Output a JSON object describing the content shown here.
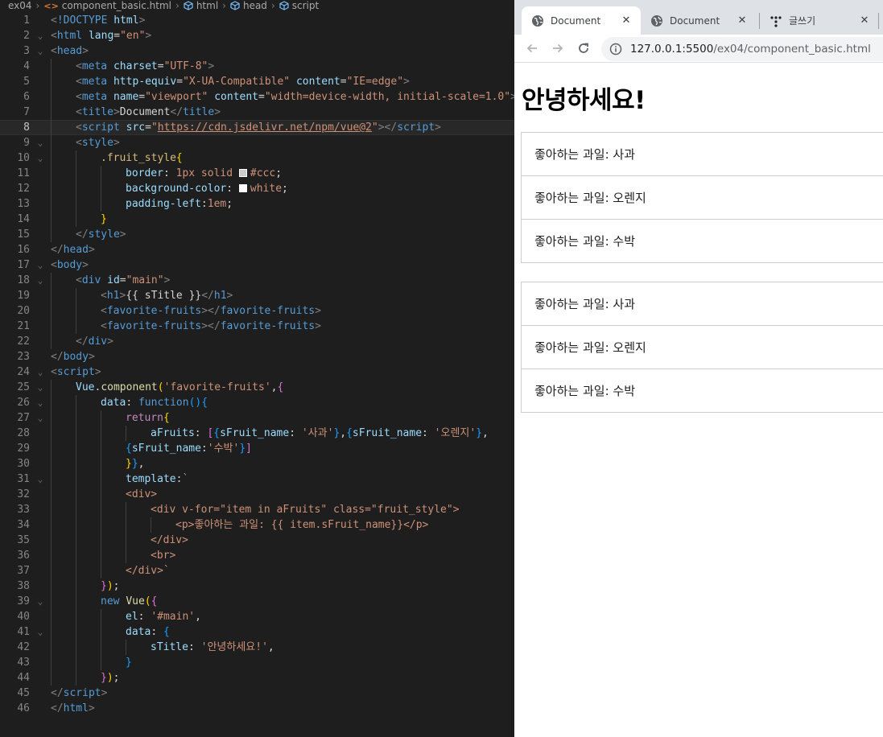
{
  "breadcrumb": [
    "ex04",
    "component_basic.html",
    "html",
    "head",
    "script"
  ],
  "code_lines": [
    {
      "n": "1",
      "fold": "",
      "indent": 0,
      "parts": [
        [
          "tp",
          "<"
        ],
        [
          "t",
          "!DOCTYPE "
        ],
        [
          "a",
          "html"
        ],
        [
          "tp",
          ">"
        ]
      ]
    },
    {
      "n": "2",
      "fold": "v",
      "indent": 0,
      "parts": [
        [
          "tp",
          "<"
        ],
        [
          "t",
          "html "
        ],
        [
          "a",
          "lang"
        ],
        [
          "w",
          "="
        ],
        [
          "s",
          "\"en\""
        ],
        [
          "tp",
          ">"
        ]
      ]
    },
    {
      "n": "3",
      "fold": "v",
      "indent": 0,
      "parts": [
        [
          "tp",
          "<"
        ],
        [
          "t",
          "head"
        ],
        [
          "tp",
          ">"
        ]
      ]
    },
    {
      "n": "4",
      "fold": "",
      "indent": 1,
      "parts": [
        [
          "tp",
          "<"
        ],
        [
          "t",
          "meta "
        ],
        [
          "a",
          "charset"
        ],
        [
          "w",
          "="
        ],
        [
          "s",
          "\"UTF-8\""
        ],
        [
          "tp",
          ">"
        ]
      ]
    },
    {
      "n": "5",
      "fold": "",
      "indent": 1,
      "parts": [
        [
          "tp",
          "<"
        ],
        [
          "t",
          "meta "
        ],
        [
          "a",
          "http-equiv"
        ],
        [
          "w",
          "="
        ],
        [
          "s",
          "\"X-UA-Compatible\""
        ],
        [
          "w",
          " "
        ],
        [
          "a",
          "content"
        ],
        [
          "w",
          "="
        ],
        [
          "s",
          "\"IE=edge\""
        ],
        [
          "tp",
          ">"
        ]
      ]
    },
    {
      "n": "6",
      "fold": "",
      "indent": 1,
      "parts": [
        [
          "tp",
          "<"
        ],
        [
          "t",
          "meta "
        ],
        [
          "a",
          "name"
        ],
        [
          "w",
          "="
        ],
        [
          "s",
          "\"viewport\""
        ],
        [
          "w",
          " "
        ],
        [
          "a",
          "content"
        ],
        [
          "w",
          "="
        ],
        [
          "s",
          "\"width=device-width, initial-scale=1.0\""
        ],
        [
          "tp",
          ">"
        ]
      ]
    },
    {
      "n": "7",
      "fold": "",
      "indent": 1,
      "parts": [
        [
          "tp",
          "<"
        ],
        [
          "t",
          "title"
        ],
        [
          "tp",
          ">"
        ],
        [
          "w",
          "Document"
        ],
        [
          "tp",
          "</"
        ],
        [
          "t",
          "title"
        ],
        [
          "tp",
          ">"
        ]
      ]
    },
    {
      "n": "8",
      "fold": "",
      "indent": 1,
      "active": true,
      "parts": [
        [
          "tp",
          "<"
        ],
        [
          "t",
          "script "
        ],
        [
          "a",
          "src"
        ],
        [
          "w",
          "="
        ],
        [
          "s",
          "\""
        ],
        [
          "su",
          "https://cdn.jsdelivr.net/npm/vue@2"
        ],
        [
          "s",
          "\""
        ],
        [
          "tp",
          "></"
        ],
        [
          "t",
          "script"
        ],
        [
          "tp",
          ">"
        ]
      ]
    },
    {
      "n": "9",
      "fold": "v",
      "indent": 1,
      "parts": [
        [
          "tp",
          "<"
        ],
        [
          "t",
          "style"
        ],
        [
          "tp",
          ">"
        ]
      ]
    },
    {
      "n": "10",
      "fold": "v",
      "indent": 2,
      "parts": [
        [
          "c",
          ".fruit_style"
        ],
        [
          "b1",
          "{"
        ]
      ]
    },
    {
      "n": "11",
      "fold": "",
      "indent": 3,
      "parts": [
        [
          "p",
          "border"
        ],
        [
          "w",
          ": "
        ],
        [
          "s",
          "1px solid "
        ],
        [
          "sw",
          "#cccccc"
        ],
        [
          "s",
          "#ccc"
        ],
        [
          "w",
          ";"
        ]
      ]
    },
    {
      "n": "12",
      "fold": "",
      "indent": 3,
      "parts": [
        [
          "p",
          "background-color"
        ],
        [
          "w",
          ": "
        ],
        [
          "sw",
          "#ffffff"
        ],
        [
          "s",
          "white"
        ],
        [
          "w",
          ";"
        ]
      ]
    },
    {
      "n": "13",
      "fold": "",
      "indent": 3,
      "parts": [
        [
          "p",
          "padding-left"
        ],
        [
          "w",
          ":"
        ],
        [
          "s",
          "1em"
        ],
        [
          "w",
          ";"
        ]
      ]
    },
    {
      "n": "14",
      "fold": "",
      "indent": 2,
      "parts": [
        [
          "b1",
          "}"
        ]
      ]
    },
    {
      "n": "15",
      "fold": "",
      "indent": 1,
      "parts": [
        [
          "tp",
          "</"
        ],
        [
          "t",
          "style"
        ],
        [
          "tp",
          ">"
        ]
      ]
    },
    {
      "n": "16",
      "fold": "",
      "indent": 0,
      "parts": [
        [
          "tp",
          "</"
        ],
        [
          "t",
          "head"
        ],
        [
          "tp",
          ">"
        ]
      ]
    },
    {
      "n": "17",
      "fold": "v",
      "indent": 0,
      "parts": [
        [
          "tp",
          "<"
        ],
        [
          "t",
          "body"
        ],
        [
          "tp",
          ">"
        ]
      ]
    },
    {
      "n": "18",
      "fold": "v",
      "indent": 1,
      "parts": [
        [
          "tp",
          "<"
        ],
        [
          "t",
          "div "
        ],
        [
          "a",
          "id"
        ],
        [
          "w",
          "="
        ],
        [
          "s",
          "\"main\""
        ],
        [
          "tp",
          ">"
        ]
      ]
    },
    {
      "n": "19",
      "fold": "",
      "indent": 2,
      "parts": [
        [
          "tp",
          "<"
        ],
        [
          "t",
          "h1"
        ],
        [
          "tp",
          ">"
        ],
        [
          "w",
          "{{ sTitle }}"
        ],
        [
          "tp",
          "</"
        ],
        [
          "t",
          "h1"
        ],
        [
          "tp",
          ">"
        ]
      ]
    },
    {
      "n": "20",
      "fold": "",
      "indent": 2,
      "parts": [
        [
          "tp",
          "<"
        ],
        [
          "t",
          "favorite-fruits"
        ],
        [
          "tp",
          "></"
        ],
        [
          "t",
          "favorite-fruits"
        ],
        [
          "tp",
          ">"
        ]
      ]
    },
    {
      "n": "21",
      "fold": "",
      "indent": 2,
      "parts": [
        [
          "tp",
          "<"
        ],
        [
          "t",
          "favorite-fruits"
        ],
        [
          "tp",
          "></"
        ],
        [
          "t",
          "favorite-fruits"
        ],
        [
          "tp",
          ">"
        ]
      ]
    },
    {
      "n": "22",
      "fold": "",
      "indent": 1,
      "parts": [
        [
          "tp",
          "</"
        ],
        [
          "t",
          "div"
        ],
        [
          "tp",
          ">"
        ]
      ]
    },
    {
      "n": "23",
      "fold": "",
      "indent": 0,
      "parts": [
        [
          "tp",
          "</"
        ],
        [
          "t",
          "body"
        ],
        [
          "tp",
          ">"
        ]
      ]
    },
    {
      "n": "24",
      "fold": "v",
      "indent": 0,
      "parts": [
        [
          "tp",
          "<"
        ],
        [
          "t",
          "script"
        ],
        [
          "tp",
          ">"
        ]
      ]
    },
    {
      "n": "25",
      "fold": "v",
      "indent": 1,
      "parts": [
        [
          "p",
          "Vue"
        ],
        [
          "w",
          "."
        ],
        [
          "f",
          "component"
        ],
        [
          "b1",
          "("
        ],
        [
          "s",
          "'favorite-fruits'"
        ],
        [
          "w",
          ","
        ],
        [
          "b2",
          "{"
        ]
      ]
    },
    {
      "n": "26",
      "fold": "v",
      "indent": 2,
      "parts": [
        [
          "p",
          "data"
        ],
        [
          "w",
          ": "
        ],
        [
          "kw",
          "function"
        ],
        [
          "b3",
          "()"
        ],
        [
          "b3",
          "{"
        ]
      ]
    },
    {
      "n": "27",
      "fold": "v",
      "indent": 3,
      "parts": [
        [
          "ctl",
          "return"
        ],
        [
          "b1",
          "{"
        ]
      ]
    },
    {
      "n": "28",
      "fold": "",
      "indent": 4,
      "parts": [
        [
          "p",
          "aFruits"
        ],
        [
          "w",
          ": "
        ],
        [
          "b2",
          "["
        ],
        [
          "b3",
          "{"
        ],
        [
          "p",
          "sFruit_name"
        ],
        [
          "w",
          ": "
        ],
        [
          "s",
          "'사과'"
        ],
        [
          "b3",
          "}"
        ],
        [
          "w",
          ","
        ],
        [
          "b3",
          "{"
        ],
        [
          "p",
          "sFruit_name"
        ],
        [
          "w",
          ": "
        ],
        [
          "s",
          "'오렌지'"
        ],
        [
          "b3",
          "}"
        ],
        [
          "w",
          ","
        ]
      ]
    },
    {
      "n": "29",
      "fold": "",
      "indent": 3,
      "parts": [
        [
          "b3",
          "{"
        ],
        [
          "p",
          "sFruit_name"
        ],
        [
          "w",
          ":"
        ],
        [
          "s",
          "'수박'"
        ],
        [
          "b3",
          "}"
        ],
        [
          "b2",
          "]"
        ]
      ]
    },
    {
      "n": "30",
      "fold": "",
      "indent": 3,
      "parts": [
        [
          "b1",
          "}"
        ],
        [
          "b3",
          "}"
        ],
        [
          "w",
          ","
        ]
      ]
    },
    {
      "n": "31",
      "fold": "v",
      "indent": 3,
      "parts": [
        [
          "p",
          "template"
        ],
        [
          "w",
          ":"
        ],
        [
          "s",
          "`"
        ]
      ]
    },
    {
      "n": "32",
      "fold": "",
      "indent": 3,
      "parts": [
        [
          "s",
          "<div>"
        ]
      ]
    },
    {
      "n": "33",
      "fold": "",
      "indent": 4,
      "parts": [
        [
          "s",
          "<div v-for=\"item in aFruits\" class=\"fruit_style\">"
        ]
      ]
    },
    {
      "n": "34",
      "fold": "",
      "indent": 5,
      "parts": [
        [
          "s",
          "<p>좋아하는 과일: {{ item.sFruit_name}}</p>"
        ]
      ]
    },
    {
      "n": "35",
      "fold": "",
      "indent": 4,
      "parts": [
        [
          "s",
          "</div>"
        ]
      ]
    },
    {
      "n": "36",
      "fold": "",
      "indent": 4,
      "parts": [
        [
          "s",
          "<br>"
        ]
      ]
    },
    {
      "n": "37",
      "fold": "",
      "indent": 3,
      "parts": [
        [
          "s",
          "</div>`"
        ]
      ]
    },
    {
      "n": "38",
      "fold": "",
      "indent": 2,
      "parts": [
        [
          "b2",
          "}"
        ],
        [
          "b1",
          ")"
        ],
        [
          "w",
          ";"
        ]
      ]
    },
    {
      "n": "39",
      "fold": "v",
      "indent": 2,
      "parts": [
        [
          "kw",
          "new "
        ],
        [
          "f",
          "Vue"
        ],
        [
          "b1",
          "("
        ],
        [
          "b2",
          "{"
        ]
      ]
    },
    {
      "n": "40",
      "fold": "",
      "indent": 3,
      "parts": [
        [
          "p",
          "el"
        ],
        [
          "w",
          ": "
        ],
        [
          "s",
          "'#main'"
        ],
        [
          "w",
          ","
        ]
      ]
    },
    {
      "n": "41",
      "fold": "v",
      "indent": 3,
      "parts": [
        [
          "p",
          "data"
        ],
        [
          "w",
          ": "
        ],
        [
          "b3",
          "{"
        ]
      ]
    },
    {
      "n": "42",
      "fold": "",
      "indent": 4,
      "parts": [
        [
          "p",
          "sTitle"
        ],
        [
          "w",
          ": "
        ],
        [
          "s",
          "'안녕하세요!'"
        ],
        [
          "w",
          ","
        ]
      ]
    },
    {
      "n": "43",
      "fold": "",
      "indent": 3,
      "parts": [
        [
          "b3",
          "}"
        ]
      ]
    },
    {
      "n": "44",
      "fold": "",
      "indent": 2,
      "parts": [
        [
          "b2",
          "}"
        ],
        [
          "b1",
          ")"
        ],
        [
          "w",
          ";"
        ]
      ]
    },
    {
      "n": "45",
      "fold": "",
      "indent": 0,
      "parts": [
        [
          "tp",
          "</"
        ],
        [
          "t",
          "script"
        ],
        [
          "tp",
          ">"
        ]
      ]
    },
    {
      "n": "46",
      "fold": "",
      "indent": 0,
      "parts": [
        [
          "tp",
          "</"
        ],
        [
          "t",
          "html"
        ],
        [
          "tp",
          ">"
        ]
      ]
    }
  ],
  "browser": {
    "tabs": [
      {
        "label": "Document",
        "close": "✕",
        "active": true
      },
      {
        "label": "Document",
        "close": "✕",
        "active": false
      },
      {
        "label": "글쓰기",
        "close": "✕",
        "active": false
      }
    ],
    "url_host": "127.0.0.1:5500",
    "url_path": "/ex04/component_basic.html"
  },
  "page": {
    "heading": "안녕하세요!",
    "groups": [
      [
        "좋아하는 과일: 사과",
        "좋아하는 과일: 오렌지",
        "좋아하는 과일: 수박"
      ],
      [
        "좋아하는 과일: 사과",
        "좋아하는 과일: 오렌지",
        "좋아하는 과일: 수박"
      ]
    ]
  }
}
